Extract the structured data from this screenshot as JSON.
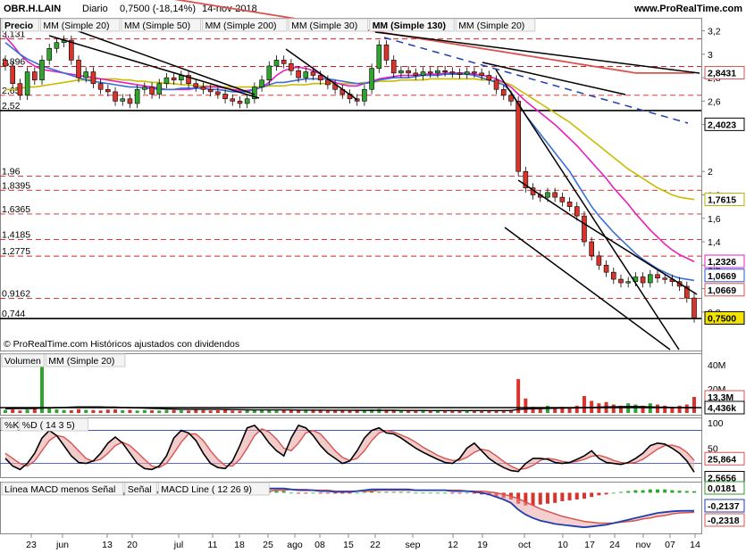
{
  "header": {
    "ticker": "OBR.H.LAIN",
    "period": "Diario",
    "quote": "0,7500 (-18,14%)",
    "date": "14-nov-2018",
    "site": "www.ProRealTime.com"
  },
  "price_panel": {
    "legend": [
      {
        "text": "Precio",
        "color": "#000000"
      },
      {
        "text": "MM (Simple 20)",
        "color": "#1f5fd6"
      },
      {
        "text": "MM (Simple 50)",
        "color": "#c8c000"
      },
      {
        "text": "MM (Simple 200)",
        "color": "#d9534f"
      },
      {
        "text": "MM (Simple 30)",
        "color": "#e81fbd"
      },
      {
        "text": "MM (Simple 130)",
        "color": "#1f3fae"
      },
      {
        "text": "MM (Simple 20)",
        "color": "#d9534f"
      }
    ],
    "footnote": "© ProRealTime.com  Históricos ajustados con dividendos",
    "level_labels": [
      "3,131",
      "2,896",
      "2,65",
      "2,52",
      "1,96",
      "1,8395",
      "1,6365",
      "1,4185",
      "1,2775",
      "0,9162",
      "0,744"
    ],
    "axis_ticks": [
      "3,2",
      "3",
      "2,8",
      "2,6",
      "2,4",
      "2",
      "1,8",
      "1,6",
      "1,4",
      "1,2",
      "1",
      "0,8"
    ],
    "badges": [
      {
        "value": "2,8431",
        "color": "#d9534f"
      },
      {
        "value": "2,4023",
        "color": "#000000"
      },
      {
        "value": "1,7615",
        "color": "#b8b000"
      },
      {
        "value": "1,2326",
        "color": "#e81fbd"
      },
      {
        "value": "1,0669",
        "color": "#1f5fd6"
      },
      {
        "value": "1,0669",
        "color": "#d9534f"
      },
      {
        "value": "0,7500",
        "color": "#000000"
      }
    ]
  },
  "volume_panel": {
    "legend": [
      {
        "text": "Volumen",
        "color": "#d9534f"
      },
      {
        "text": "MM (Simple 20)",
        "color": "#000000"
      }
    ],
    "axis_ticks": [
      "40M",
      "20M"
    ],
    "badges": [
      {
        "value": "13,3M",
        "color": "#d9534f"
      },
      {
        "value": "4,436k",
        "color": "#000000"
      }
    ]
  },
  "stoch_panel": {
    "legend": [
      {
        "text": "%K",
        "color": "#000000"
      },
      {
        "text": "%D ( 14 3 5)",
        "color": "#d9534f"
      }
    ],
    "axis_ticks": [
      "100",
      "50",
      "0"
    ],
    "badges": [
      {
        "value": "25,864",
        "color": "#d9534f"
      },
      {
        "value": "2,5656",
        "color": "#000000"
      }
    ]
  },
  "macd_panel": {
    "legend": [
      {
        "text": "Línea MACD menos Señal",
        "color": "#2e9e2e"
      },
      {
        "text": "Señal",
        "color": "#d9534f"
      },
      {
        "text": "MACD Line ( 12 26 9)",
        "color": "#1f3fae"
      }
    ],
    "badges": [
      {
        "value": "0,0181",
        "color": "#2e9e2e"
      },
      {
        "value": "-0,2137",
        "color": "#1f3fae"
      },
      {
        "value": "-0,2318",
        "color": "#d9534f"
      }
    ]
  },
  "x_axis": {
    "labels": [
      "23",
      "jun",
      "13",
      "20",
      "jul",
      "11",
      "18",
      "25",
      "ago",
      "08",
      "15",
      "22",
      "sep",
      "12",
      "19",
      "oct",
      "10",
      "17",
      "24",
      "nov",
      "07",
      "14"
    ]
  },
  "colors": {
    "sma20": "#3a6fd8",
    "sma50": "#c8bc00",
    "sma200": "#d9534f",
    "sma30": "#e81fbd",
    "up": "#2fa52f",
    "down": "#d9342b",
    "level": "#d22020"
  },
  "chart_data": {
    "type": "candlestick",
    "title": "OBR.H.LAIN Diario",
    "y_range": [
      0.7,
      3.25
    ],
    "closes": [
      2.9,
      2.75,
      2.65,
      2.85,
      2.78,
      2.95,
      3.05,
      3.1,
      3.12,
      2.95,
      2.8,
      2.85,
      2.75,
      2.7,
      2.68,
      2.6,
      2.62,
      2.58,
      2.7,
      2.72,
      2.66,
      2.75,
      2.8,
      2.78,
      2.82,
      2.75,
      2.72,
      2.7,
      2.68,
      2.66,
      2.62,
      2.6,
      2.58,
      2.62,
      2.72,
      2.78,
      2.9,
      2.95,
      2.92,
      2.86,
      2.8,
      2.85,
      2.82,
      2.78,
      2.74,
      2.7,
      2.66,
      2.62,
      2.6,
      2.7,
      2.88,
      3.08,
      2.95,
      2.84,
      2.86,
      2.84,
      2.82,
      2.85,
      2.84,
      2.86,
      2.85,
      2.84,
      2.83,
      2.85,
      2.84,
      2.82,
      2.78,
      2.7,
      2.65,
      2.6,
      2.0,
      1.86,
      1.8,
      1.78,
      1.82,
      1.78,
      1.74,
      1.7,
      1.62,
      1.4,
      1.28,
      1.2,
      1.14,
      1.08,
      1.05,
      1.06,
      1.1,
      1.05,
      1.12,
      1.09,
      1.08,
      1.06,
      1.02,
      0.92,
      0.75
    ],
    "sma20": [
      3.1,
      3.05,
      3.0,
      2.96,
      2.93,
      2.9,
      2.88,
      2.86,
      2.84,
      2.82,
      2.8,
      2.78,
      2.77,
      2.76,
      2.75,
      2.74,
      2.73,
      2.72,
      2.72,
      2.71,
      2.71,
      2.7,
      2.7,
      2.7,
      2.71,
      2.71,
      2.71,
      2.71,
      2.7,
      2.7,
      2.69,
      2.68,
      2.68,
      2.68,
      2.7,
      2.72,
      2.74,
      2.76,
      2.76,
      2.77,
      2.78,
      2.79,
      2.79,
      2.79,
      2.79,
      2.78,
      2.77,
      2.76,
      2.75,
      2.75,
      2.76,
      2.78,
      2.79,
      2.8,
      2.8,
      2.8,
      2.81,
      2.82,
      2.82,
      2.82,
      2.83,
      2.83,
      2.83,
      2.83,
      2.82,
      2.8,
      2.78,
      2.76,
      2.74,
      2.68,
      2.58,
      2.48,
      2.4,
      2.32,
      2.24,
      2.16,
      2.08,
      2.0,
      1.9,
      1.8,
      1.7,
      1.62,
      1.55,
      1.48,
      1.42,
      1.36,
      1.3,
      1.25,
      1.21,
      1.17,
      1.14,
      1.11,
      1.09,
      1.08,
      1.07
    ],
    "sma50": [
      2.7,
      2.7,
      2.71,
      2.72,
      2.72,
      2.73,
      2.74,
      2.75,
      2.76,
      2.77,
      2.78,
      2.78,
      2.79,
      2.79,
      2.79,
      2.79,
      2.78,
      2.78,
      2.77,
      2.77,
      2.76,
      2.76,
      2.75,
      2.75,
      2.74,
      2.74,
      2.73,
      2.73,
      2.73,
      2.72,
      2.72,
      2.72,
      2.72,
      2.72,
      2.72,
      2.72,
      2.73,
      2.73,
      2.73,
      2.74,
      2.74,
      2.74,
      2.75,
      2.75,
      2.75,
      2.75,
      2.75,
      2.75,
      2.75,
      2.76,
      2.76,
      2.77,
      2.77,
      2.77,
      2.78,
      2.78,
      2.78,
      2.78,
      2.79,
      2.79,
      2.79,
      2.79,
      2.79,
      2.79,
      2.79,
      2.78,
      2.78,
      2.77,
      2.76,
      2.74,
      2.7,
      2.66,
      2.62,
      2.58,
      2.54,
      2.5,
      2.46,
      2.42,
      2.37,
      2.32,
      2.27,
      2.22,
      2.17,
      2.12,
      2.07,
      2.02,
      1.98,
      1.94,
      1.9,
      1.86,
      1.83,
      1.8,
      1.78,
      1.77,
      1.76
    ],
    "sma30": [
      3.15,
      3.08,
      3.0,
      2.94,
      2.9,
      2.87,
      2.86,
      2.85,
      2.84,
      2.83,
      2.82,
      2.81,
      2.8,
      2.79,
      2.78,
      2.77,
      2.76,
      2.75,
      2.74,
      2.73,
      2.72,
      2.71,
      2.7,
      2.7,
      2.7,
      2.7,
      2.71,
      2.72,
      2.72,
      2.72,
      2.71,
      2.7,
      2.69,
      2.69,
      2.7,
      2.72,
      2.76,
      2.82,
      2.86,
      2.88,
      2.89,
      2.88,
      2.86,
      2.83,
      2.79,
      2.76,
      2.74,
      2.73,
      2.73,
      2.75,
      2.77,
      2.79,
      2.8,
      2.81,
      2.82,
      2.82,
      2.82,
      2.83,
      2.83,
      2.83,
      2.84,
      2.84,
      2.84,
      2.84,
      2.83,
      2.82,
      2.81,
      2.79,
      2.76,
      2.72,
      2.66,
      2.6,
      2.55,
      2.5,
      2.45,
      2.4,
      2.34,
      2.28,
      2.22,
      2.15,
      2.08,
      2.01,
      1.94,
      1.86,
      1.79,
      1.72,
      1.64,
      1.57,
      1.5,
      1.44,
      1.38,
      1.33,
      1.29,
      1.26,
      1.23
    ],
    "sma200": [
      3.7,
      3.69,
      3.68,
      3.67,
      3.66,
      3.65,
      3.64,
      3.63,
      3.62,
      3.61,
      3.6,
      3.59,
      3.58,
      3.57,
      3.56,
      3.55,
      3.54,
      3.53,
      3.52,
      3.51,
      3.5,
      3.49,
      3.48,
      3.47,
      3.46,
      3.45,
      3.44,
      3.43,
      3.42,
      3.41,
      3.4,
      3.39,
      3.38,
      3.37,
      3.36,
      3.35,
      3.34,
      3.33,
      3.32,
      3.31,
      3.3,
      3.29,
      3.28,
      3.27,
      3.26,
      3.25,
      3.24,
      3.23,
      3.22,
      3.21,
      3.2,
      3.19,
      3.18,
      3.17,
      3.16,
      3.15,
      3.14,
      3.13,
      3.12,
      3.11,
      3.1,
      3.09,
      3.08,
      3.07,
      3.06,
      3.05,
      3.04,
      3.03,
      3.02,
      3.01,
      3.0,
      2.99,
      2.98,
      2.97,
      2.96,
      2.95,
      2.94,
      2.93,
      2.92,
      2.91,
      2.9,
      2.89,
      2.88,
      2.87,
      2.86,
      2.85,
      2.84,
      2.84,
      2.84,
      2.84,
      2.84,
      2.84,
      2.84,
      2.84,
      2.84
    ],
    "volume": [
      2.5,
      3.0,
      2.0,
      2.8,
      3.5,
      46,
      4.0,
      3.0,
      2.5,
      2.2,
      3.2,
      2.6,
      2.4,
      2.0,
      2.8,
      3.0,
      2.2,
      2.6,
      2.0,
      2.4,
      2.2,
      2.0,
      2.6,
      2.4,
      2.2,
      2.0,
      2.8,
      2.4,
      2.0,
      2.2,
      2.6,
      2.0,
      1.8,
      2.2,
      2.6,
      3.0,
      2.4,
      2.0,
      2.2,
      2.6,
      2.0,
      1.8,
      2.2,
      2.0,
      1.8,
      2.0,
      2.2,
      2.0,
      1.8,
      2.2,
      2.8,
      3.2,
      2.4,
      2.0,
      1.8,
      2.0,
      1.8,
      2.0,
      1.6,
      1.8,
      1.6,
      1.8,
      1.6,
      1.8,
      1.6,
      1.8,
      2.0,
      2.2,
      2.4,
      2.6,
      28,
      12,
      5,
      4,
      6,
      4,
      5,
      4,
      6,
      14,
      10,
      8,
      9,
      7,
      6,
      8,
      7,
      6,
      8,
      7,
      6,
      5,
      6,
      7,
      13.3
    ],
    "volume_sma20": [
      3.5,
      3.6,
      3.7,
      3.7,
      3.8,
      4.0,
      4.2,
      4.4,
      4.6,
      4.8,
      5.0,
      5.0,
      5.0,
      5.0,
      4.9,
      4.8,
      4.6,
      4.4,
      4.2,
      4.0,
      3.8,
      3.6,
      3.4,
      3.2,
      3.0,
      3.0,
      3.0,
      3.0,
      3.0,
      3.0,
      2.9,
      2.8,
      2.7,
      2.6,
      2.5,
      2.5,
      2.5,
      2.5,
      2.5,
      2.5,
      2.4,
      2.4,
      2.4,
      2.4,
      2.3,
      2.3,
      2.3,
      2.3,
      2.2,
      2.2,
      2.2,
      2.2,
      2.2,
      2.2,
      2.1,
      2.1,
      2.1,
      2.1,
      2.0,
      2.0,
      2.0,
      2.0,
      2.0,
      2.0,
      2.0,
      2.0,
      2.0,
      2.0,
      2.0,
      2.0,
      3.0,
      3.3,
      3.5,
      3.6,
      3.8,
      3.9,
      4.0,
      4.1,
      4.2,
      4.4,
      4.6,
      4.8,
      5.0,
      5.1,
      5.2,
      5.3,
      5.3,
      5.2,
      5.0,
      4.9,
      4.8,
      4.6,
      4.5,
      4.4,
      4.4
    ],
    "stoch_k": [
      30,
      15,
      8,
      20,
      40,
      70,
      85,
      75,
      55,
      35,
      22,
      20,
      25,
      40,
      60,
      72,
      60,
      40,
      20,
      10,
      8,
      15,
      35,
      70,
      85,
      80,
      65,
      40,
      20,
      12,
      10,
      25,
      55,
      90,
      95,
      80,
      60,
      45,
      35,
      70,
      95,
      90,
      75,
      55,
      40,
      30,
      20,
      25,
      45,
      70,
      85,
      90,
      80,
      78,
      70,
      60,
      50,
      42,
      35,
      28,
      22,
      20,
      30,
      50,
      60,
      45,
      30,
      20,
      12,
      6,
      4,
      20,
      30,
      30,
      28,
      22,
      20,
      22,
      28,
      35,
      45,
      30,
      22,
      20,
      18,
      22,
      30,
      40,
      55,
      60,
      58,
      50,
      40,
      25,
      3
    ],
    "stoch_d": [
      40,
      30,
      20,
      15,
      25,
      45,
      65,
      75,
      72,
      60,
      45,
      30,
      24,
      28,
      40,
      55,
      62,
      55,
      42,
      28,
      15,
      12,
      20,
      40,
      62,
      78,
      78,
      65,
      45,
      28,
      16,
      15,
      28,
      50,
      75,
      88,
      82,
      68,
      50,
      45,
      60,
      80,
      85,
      78,
      62,
      45,
      32,
      26,
      30,
      45,
      65,
      80,
      85,
      82,
      76,
      70,
      62,
      52,
      44,
      36,
      30,
      26,
      26,
      32,
      42,
      48,
      45,
      35,
      24,
      15,
      8,
      10,
      16,
      26,
      30,
      28,
      24,
      22,
      24,
      28,
      34,
      36,
      32,
      26,
      22,
      20,
      22,
      28,
      38,
      48,
      55,
      56,
      52,
      42,
      26
    ],
    "macd": [
      0.06,
      0.05,
      0.03,
      0.02,
      0.02,
      0.03,
      0.04,
      0.05,
      0.04,
      0.03,
      0.02,
      0.01,
      0.0,
      -0.01,
      -0.01,
      -0.02,
      -0.02,
      -0.02,
      -0.01,
      0.0,
      0.0,
      0.01,
      0.02,
      0.02,
      0.02,
      0.01,
      0.0,
      -0.01,
      -0.01,
      -0.02,
      -0.02,
      -0.02,
      -0.01,
      0.0,
      0.02,
      0.04,
      0.05,
      0.05,
      0.05,
      0.04,
      0.03,
      0.03,
      0.03,
      0.02,
      0.02,
      0.01,
      0.01,
      0.01,
      0.02,
      0.03,
      0.04,
      0.04,
      0.04,
      0.04,
      0.04,
      0.04,
      0.03,
      0.03,
      0.03,
      0.03,
      0.03,
      0.02,
      0.02,
      0.02,
      0.01,
      0.0,
      -0.02,
      -0.05,
      -0.08,
      -0.12,
      -0.2,
      -0.26,
      -0.3,
      -0.33,
      -0.35,
      -0.37,
      -0.38,
      -0.39,
      -0.4,
      -0.41,
      -0.4,
      -0.39,
      -0.38,
      -0.36,
      -0.34,
      -0.32,
      -0.3,
      -0.28,
      -0.26,
      -0.24,
      -0.23,
      -0.22,
      -0.215,
      -0.214,
      -0.2137
    ],
    "macd_signal": [
      0.02,
      0.03,
      0.03,
      0.03,
      0.03,
      0.03,
      0.03,
      0.03,
      0.04,
      0.04,
      0.03,
      0.03,
      0.02,
      0.02,
      0.01,
      0.0,
      0.0,
      -0.01,
      -0.01,
      -0.01,
      -0.01,
      0.0,
      0.0,
      0.01,
      0.01,
      0.01,
      0.01,
      0.01,
      0.0,
      0.0,
      -0.01,
      -0.01,
      -0.01,
      -0.01,
      0.0,
      0.01,
      0.02,
      0.03,
      0.03,
      0.04,
      0.04,
      0.04,
      0.03,
      0.03,
      0.03,
      0.02,
      0.02,
      0.02,
      0.02,
      0.02,
      0.02,
      0.03,
      0.03,
      0.03,
      0.03,
      0.03,
      0.03,
      0.03,
      0.03,
      0.03,
      0.03,
      0.03,
      0.03,
      0.02,
      0.02,
      0.02,
      0.01,
      0.0,
      -0.02,
      -0.04,
      -0.07,
      -0.11,
      -0.15,
      -0.19,
      -0.22,
      -0.25,
      -0.28,
      -0.3,
      -0.32,
      -0.34,
      -0.35,
      -0.36,
      -0.36,
      -0.36,
      -0.35,
      -0.34,
      -0.33,
      -0.31,
      -0.3,
      -0.28,
      -0.27,
      -0.25,
      -0.24,
      -0.235,
      -0.2318
    ]
  }
}
